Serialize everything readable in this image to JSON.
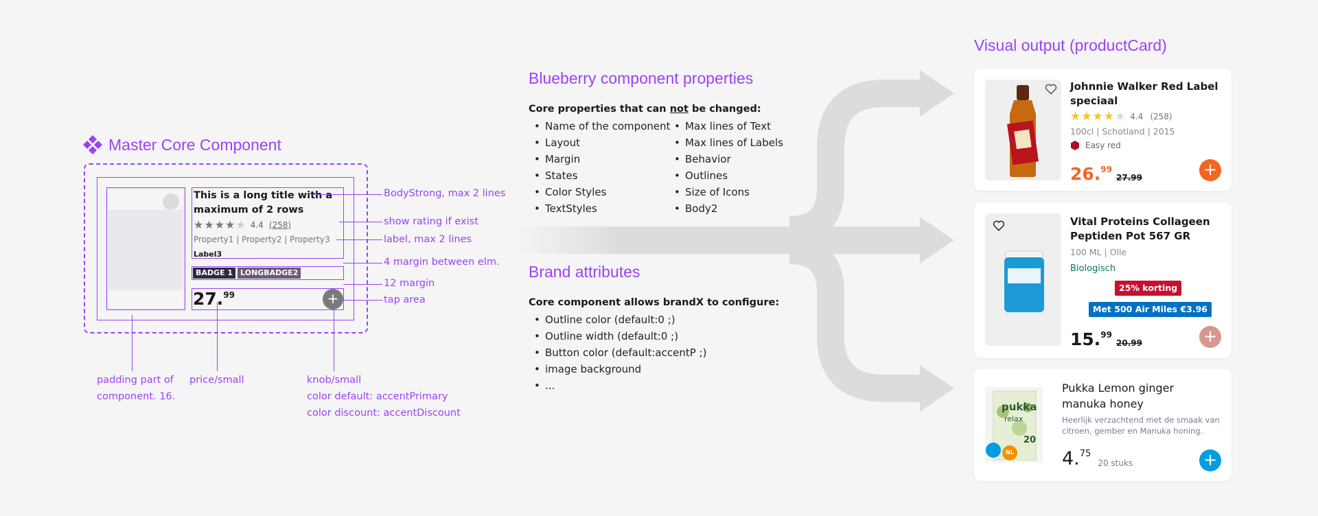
{
  "master": {
    "title": "Master Core Component",
    "card_title": "This is a long title with a maximum of 2 rows",
    "rating": "4.4",
    "reviews": "(258)",
    "properties": "Property1 | Property2 | Property3",
    "label3": "Label3",
    "badge1": "BADGE 1",
    "badge2": "LONGBADGE2",
    "price_main": "27.",
    "price_sup": "99",
    "knob_symbol": "+"
  },
  "annotations": {
    "body_strong": "BodyStrong, max 2 lines",
    "rating": "show rating if exist",
    "label": "label, max 2 lines",
    "margin4": "4 margin between elm.",
    "margin12": "12 margin",
    "tap": "tap area",
    "padding_l1": "padding part of",
    "padding_l2": "component. 16.",
    "price": "price/small",
    "knob_l1": "knob/small",
    "knob_l2": "color default: accentPrimary",
    "knob_l3": "color discount: accentDiscount"
  },
  "props": {
    "title": "Blueberry component properties",
    "subtitle_pre": "Core properties that can ",
    "subtitle_not": "not",
    "subtitle_post": " be changed:",
    "col1": [
      "Name of the component",
      "Layout",
      "Margin",
      "States",
      "Color Styles",
      "TextStyles"
    ],
    "col2": [
      "Max lines of Text",
      "Max lines of Labels",
      "Behavior",
      "Outlines",
      "Size of Icons",
      "Body2"
    ]
  },
  "brand": {
    "title": "Brand attributes",
    "subtitle": "Core component allows brandX to configure:",
    "items": [
      "Outline color (default:0 ;)",
      "Outline width (default:0 ;)",
      "Button color  (default:accentP ;)",
      "image background",
      "..."
    ]
  },
  "visual": {
    "title": "Visual output (productCard)",
    "card1": {
      "title": "Johnnie Walker Red Label speciaal",
      "rating": "4.4",
      "reviews": "(258)",
      "props": "100cl | Schotland | 2015",
      "label": "Easy red",
      "price_main": "26.",
      "price_sup": "99",
      "old_price": "27.99",
      "button": "+"
    },
    "card2": {
      "title": "Vital Proteins Collageen Peptiden Pot 567 GR",
      "props": "100 ML | Olle",
      "label": "Biologisch",
      "badge1": "25% korting",
      "badge2": "Met 500 Air Miles €3.96",
      "price_main": "15.",
      "price_sup": "99",
      "old_price": "20.99",
      "button": "+"
    },
    "card3": {
      "title": "Pukka Lemon ginger manuka honey",
      "desc": "Heerlijk verzachtend met de smaak van citroen, gember en Manuka honing.",
      "price_main": "4.",
      "price_sup": "75",
      "unit": "20 stuks",
      "button": "+",
      "pack_brand": "pukka",
      "pack_line": "relax",
      "pack_count": "20",
      "pack_country": "NL"
    }
  },
  "colors": {
    "accent": "#9c42f5",
    "orange": "#f26522",
    "blue": "#009ee0",
    "discount_red": "#c8102e",
    "airmiles_blue": "#0071c5",
    "bio_green": "#00785a"
  }
}
